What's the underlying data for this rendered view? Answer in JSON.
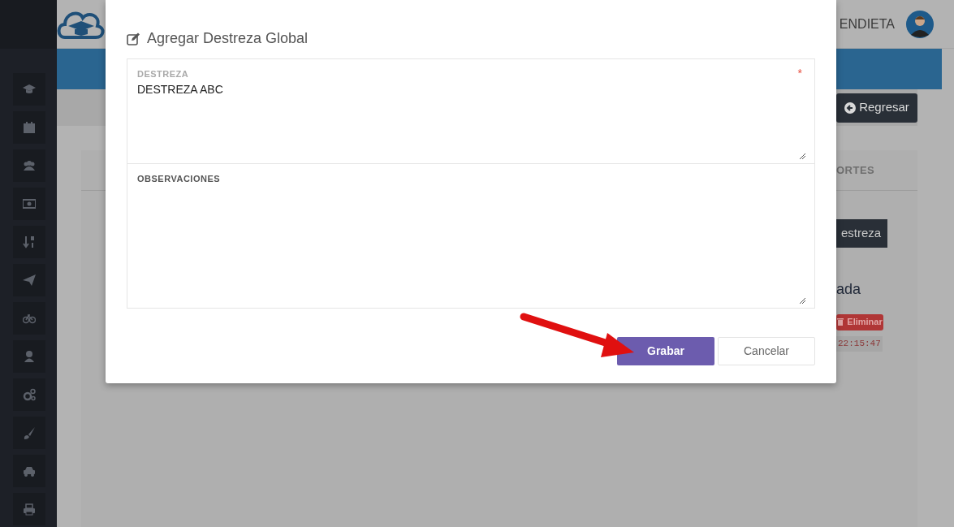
{
  "header": {
    "user_name": "ENDIETA"
  },
  "toolbar": {
    "back_button": "Regresar"
  },
  "tabs": [
    {
      "label": "ORTES",
      "selected": false
    }
  ],
  "background": {
    "add_button": "estreza",
    "heading": "ada",
    "delete_button": "Eliminar",
    "timestamp": "22:15:47"
  },
  "modal": {
    "title": "Agregar Destreza Global",
    "fields": [
      {
        "label": "DESTREZA",
        "value": "DESTREZA ABC",
        "required_mark": "*"
      },
      {
        "label": "OBSERVACIONES"
      }
    ],
    "buttons": [
      {
        "label": "Grabar",
        "kind": "primary"
      },
      {
        "label": "Cancelar",
        "kind": "secondary"
      }
    ]
  }
}
